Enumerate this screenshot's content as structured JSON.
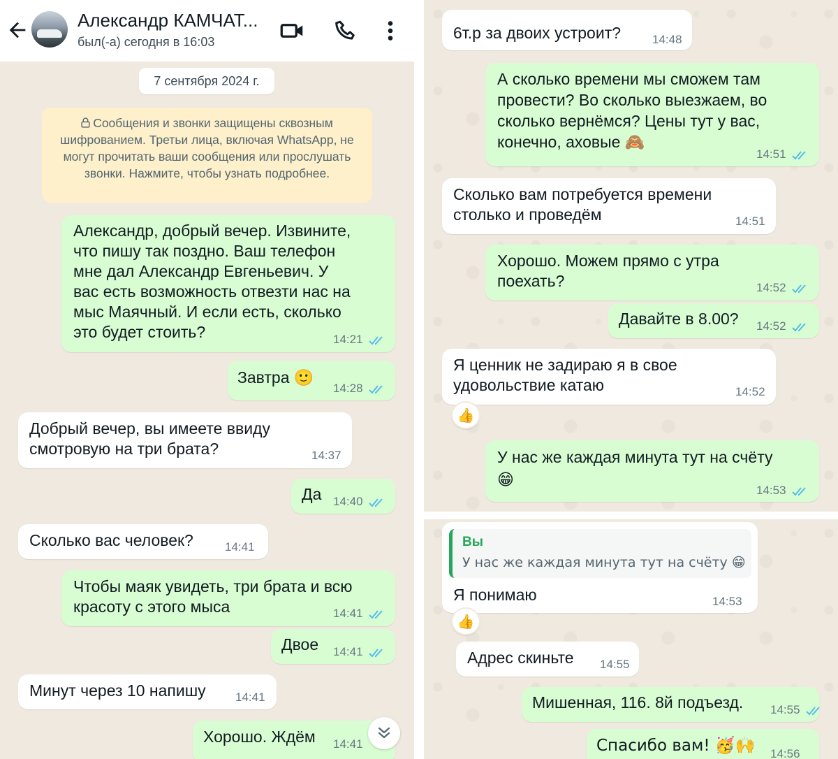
{
  "header": {
    "contact_name": "Александр КАМЧАТ...",
    "status": "был(-а) сегодня в 16:03",
    "icons": [
      "back-arrow-icon",
      "video-call-icon",
      "phone-icon",
      "more-vert-icon"
    ]
  },
  "date_chip": "7 сентября 2024 г.",
  "encryption_notice": "Сообщения и звонки защищены сквозным шифрованием. Третьи лица, включая WhatsApp, не могут прочитать ваши сообщения или прослушать звонки. Нажмите, чтобы узнать подробнее.",
  "colors": {
    "outgoing_bubble": "#d9fdd3",
    "incoming_bubble": "#ffffff",
    "read_ticks": "#53bdeb",
    "chat_background": "#efe9df",
    "quote_accent": "#25a65b"
  },
  "left_messages": [
    {
      "dir": "out",
      "text": "Александр, добрый вечер. Извините,\nчто пишу так поздно. Ваш телефон\nмне дал     Александр Евгеньевич. У\nвас есть возможность отвезти нас на\nмыс Маячный. И если есть, сколько\nэто будет стоить?",
      "time": "14:21",
      "read": true
    },
    {
      "dir": "out",
      "text": "Завтра 🙂",
      "time": "14:28",
      "read": true
    },
    {
      "dir": "in",
      "text": "Добрый вечер, вы имеете ввиду\nсмотровую на три брата?",
      "time": "14:37"
    },
    {
      "dir": "out",
      "text": "Да",
      "time": "14:40",
      "read": true
    },
    {
      "dir": "in",
      "text": "Сколько вас человек?",
      "time": "14:41"
    },
    {
      "dir": "out",
      "text": "Чтобы маяк увидеть, три брата и всю\nкрасоту с этого мыса",
      "time": "14:41",
      "read": true
    },
    {
      "dir": "out",
      "text": "Двое",
      "time": "14:41",
      "read": true
    },
    {
      "dir": "in",
      "text": "Минут через 10 напишу",
      "time": "14:41"
    },
    {
      "dir": "out",
      "text": "Хорошо. Ждём",
      "time": "14:41",
      "read": true
    }
  ],
  "right_top_messages": [
    {
      "dir": "in",
      "text": "6т.р за двоих устроит?",
      "time": "14:48"
    },
    {
      "dir": "out",
      "text": "А сколько времени мы сможем там\nпровести? Во сколько выезжаем, во\nсколько вернёмся? Цены тут у вас,\nконечно, аховые 🙈",
      "time": "14:51",
      "read": true
    },
    {
      "dir": "in",
      "text": "Сколько вам потребуется времени\nстолько и проведём",
      "time": "14:51"
    },
    {
      "dir": "out",
      "text": "Хорошо. Можем прямо с утра\nпоехать?",
      "time": "14:52",
      "read": true
    },
    {
      "dir": "out",
      "text": "Давайте в 8.00?",
      "time": "14:52",
      "read": true
    },
    {
      "dir": "in",
      "text": "Я ценник не задираю я в свое\nудовольствие катаю",
      "time": "14:52",
      "reaction": "👍"
    },
    {
      "dir": "out",
      "text": "У нас же каждая минута тут на счёту\n😁",
      "time": "14:53",
      "read": true
    }
  ],
  "right_bottom_messages": [
    {
      "dir": "in",
      "quote_author": "Вы",
      "quote_text": "У нас же каждая минута тут на счёту 😁",
      "text": "Я понимаю",
      "time": "14:53",
      "reaction": "👍"
    },
    {
      "dir": "in",
      "text": "Адрес скиньте",
      "time": "14:55"
    },
    {
      "dir": "out",
      "text": "Мишенная, 116. 8й подъезд.",
      "time": "14:55",
      "read": true
    },
    {
      "dir": "out",
      "text": "Спасибо вам! 🥳🙌",
      "time": "14:56",
      "read": true
    }
  ]
}
